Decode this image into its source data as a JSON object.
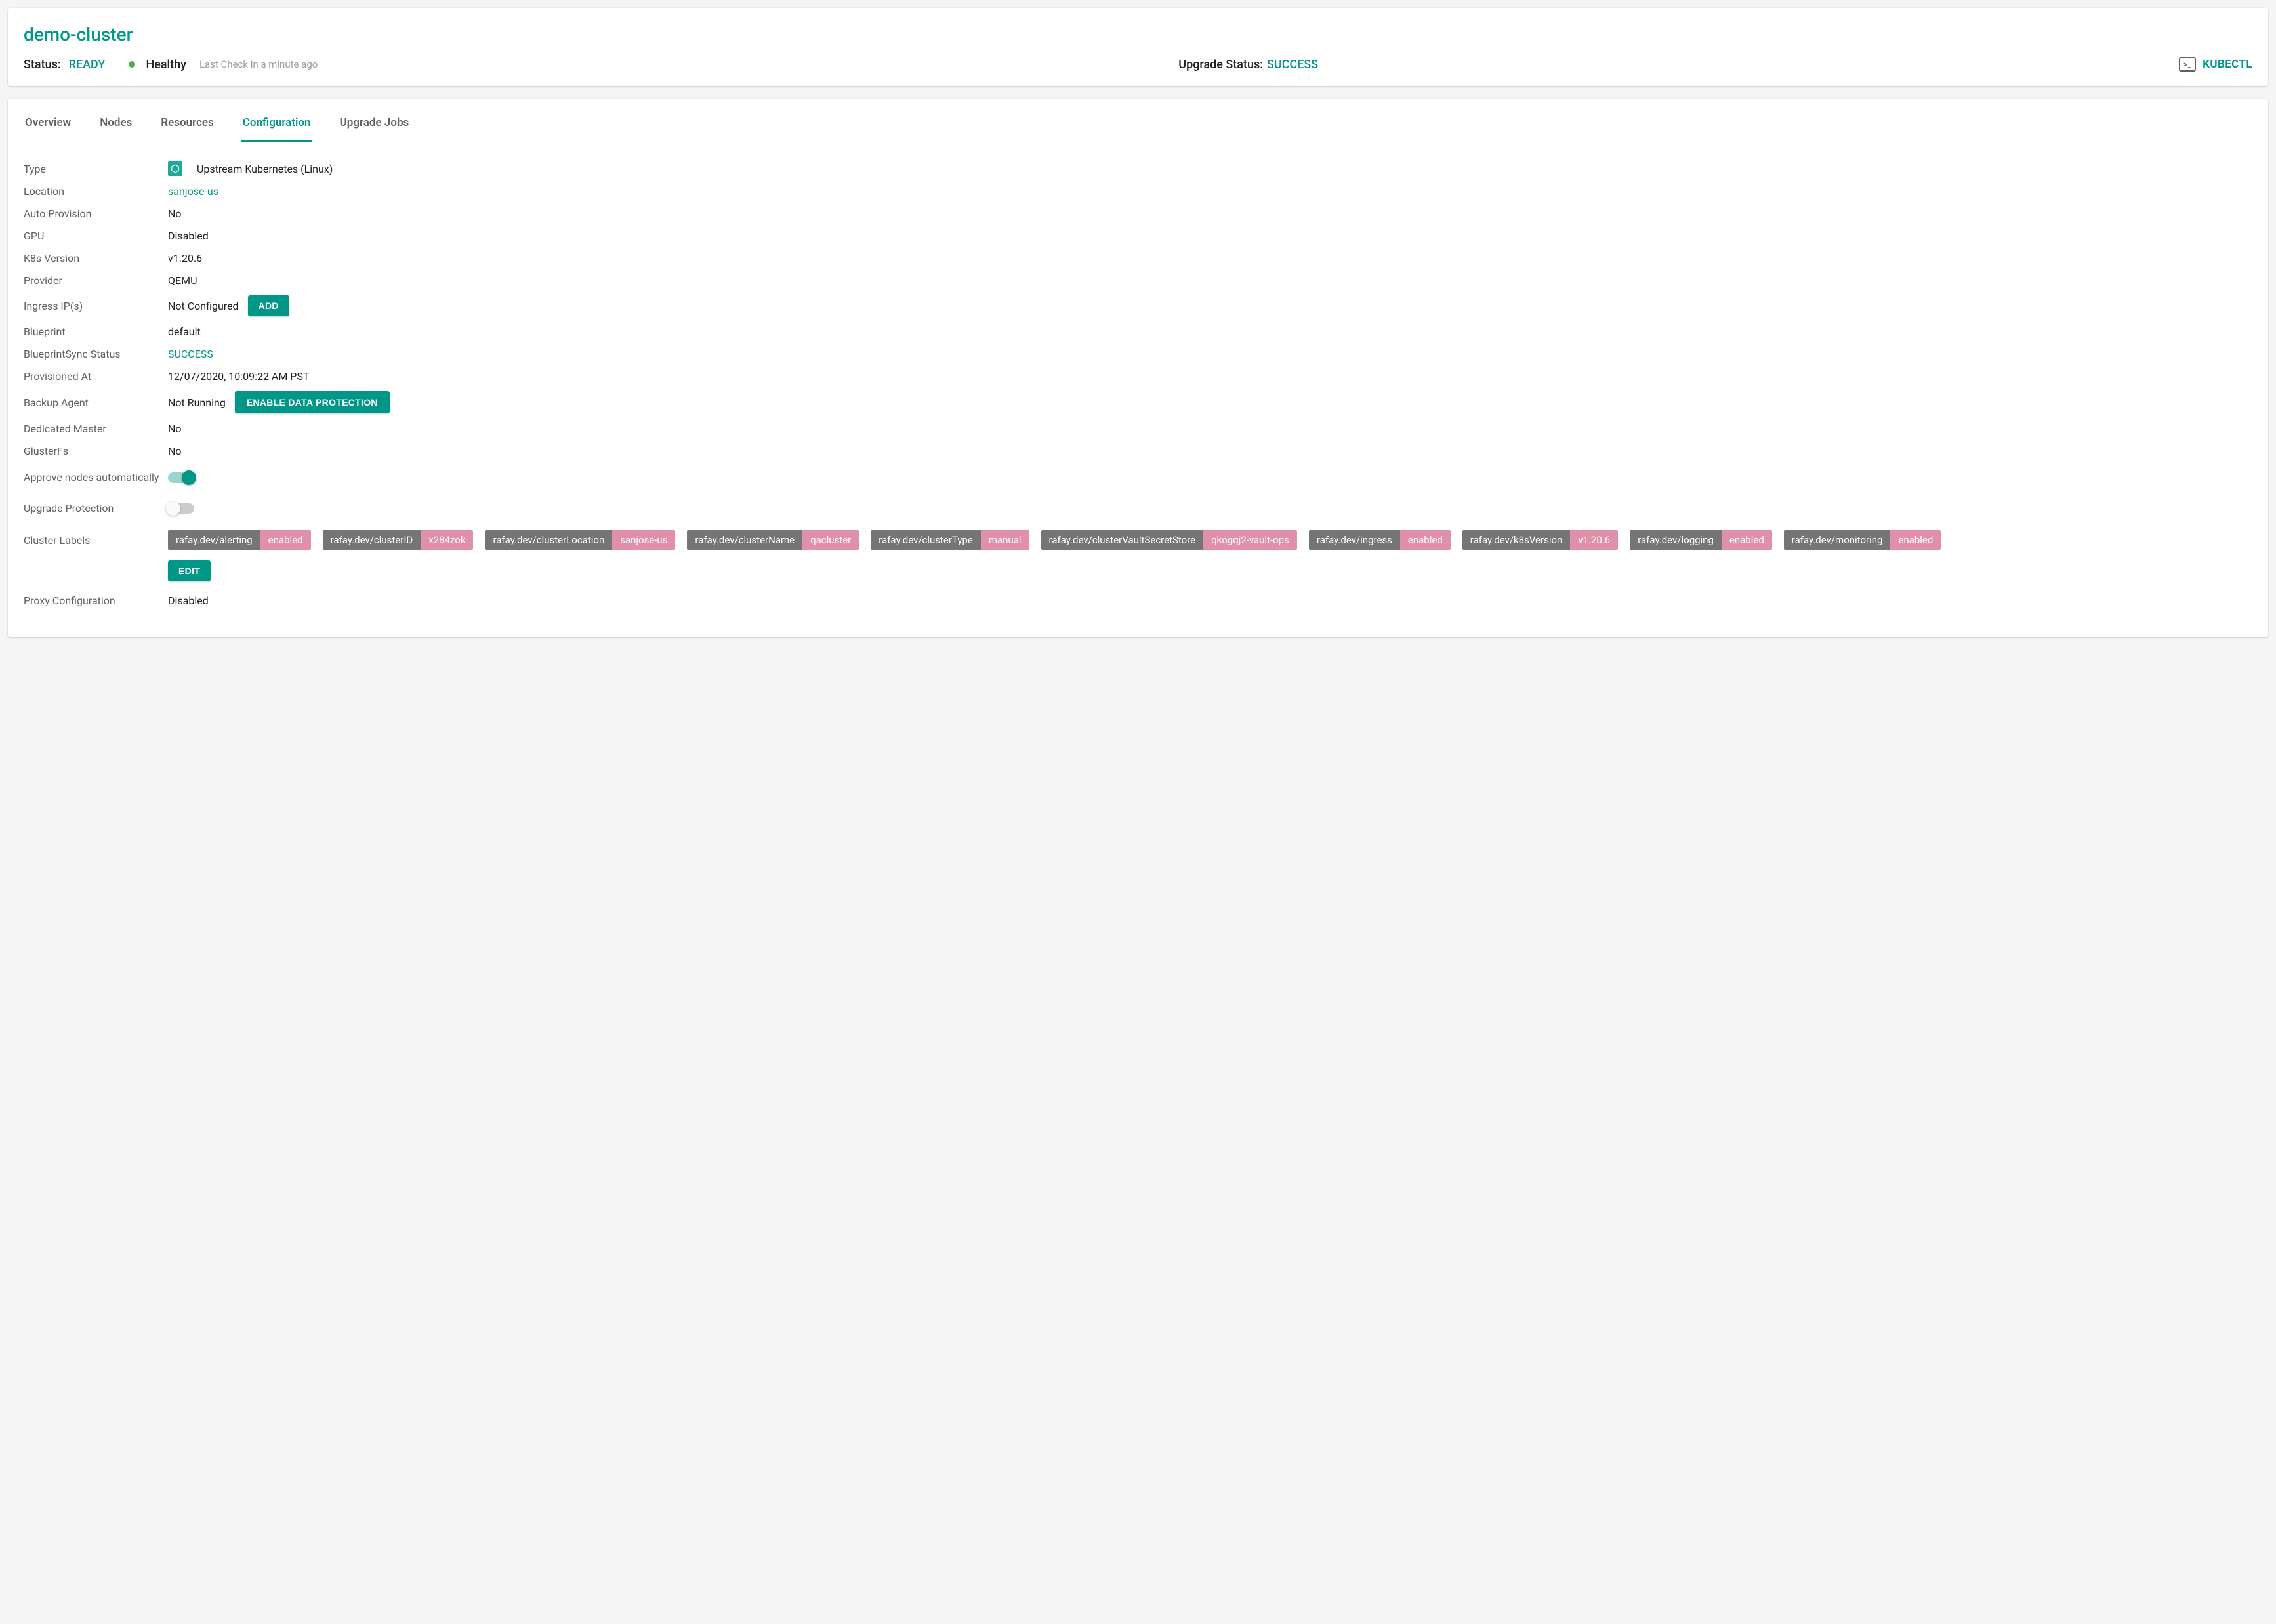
{
  "header": {
    "title": "demo-cluster",
    "status_label": "Status:",
    "status_value": "READY",
    "health_text": "Healthy",
    "last_check": "Last Check in a minute ago",
    "upgrade_label": "Upgrade Status:",
    "upgrade_value": "SUCCESS",
    "kubectl": "KUBECTL",
    "terminal_glyph": ">_"
  },
  "tabs": [
    "Overview",
    "Nodes",
    "Resources",
    "Configuration",
    "Upgrade Jobs"
  ],
  "active_tab_index": 3,
  "config": {
    "type_label": "Type",
    "type_value": "Upstream Kubernetes (Linux)",
    "location_label": "Location",
    "location_value": "sanjose-us",
    "auto_provision_label": "Auto Provision",
    "auto_provision_value": "No",
    "gpu_label": "GPU",
    "gpu_value": "Disabled",
    "k8s_version_label": "K8s Version",
    "k8s_version_value": "v1.20.6",
    "provider_label": "Provider",
    "provider_value": "QEMU",
    "ingress_label": "Ingress IP(s)",
    "ingress_value": "Not Configured",
    "ingress_add_btn": "ADD",
    "blueprint_label": "Blueprint",
    "blueprint_value": "default",
    "blueprint_sync_label": "BlueprintSync Status",
    "blueprint_sync_value": "SUCCESS",
    "provisioned_label": "Provisioned At",
    "provisioned_value": "12/07/2020, 10:09:22 AM PST",
    "backup_label": "Backup Agent",
    "backup_value": "Not Running",
    "backup_btn": "ENABLE DATA PROTECTION",
    "dedicated_master_label": "Dedicated Master",
    "dedicated_master_value": "No",
    "glusterfs_label": "GlusterFs",
    "glusterfs_value": "No",
    "approve_nodes_label": "Approve nodes automatically",
    "approve_nodes_on": true,
    "upgrade_protection_label": "Upgrade Protection",
    "upgrade_protection_on": false,
    "cluster_labels_label": "Cluster Labels",
    "edit_btn": "EDIT",
    "proxy_label": "Proxy Configuration",
    "proxy_value": "Disabled"
  },
  "cluster_labels": [
    {
      "k": "rafay.dev/alerting",
      "v": "enabled"
    },
    {
      "k": "rafay.dev/clusterID",
      "v": "x284zok"
    },
    {
      "k": "rafay.dev/clusterLocation",
      "v": "sanjose-us"
    },
    {
      "k": "rafay.dev/clusterName",
      "v": "qacluster"
    },
    {
      "k": "rafay.dev/clusterType",
      "v": "manual"
    },
    {
      "k": "rafay.dev/clusterVaultSecretStore",
      "v": "qkogqj2-vault-ops"
    },
    {
      "k": "rafay.dev/ingress",
      "v": "enabled"
    },
    {
      "k": "rafay.dev/k8sVersion",
      "v": "v1.20.6"
    },
    {
      "k": "rafay.dev/logging",
      "v": "enabled"
    },
    {
      "k": "rafay.dev/monitoring",
      "v": "enabled"
    }
  ]
}
